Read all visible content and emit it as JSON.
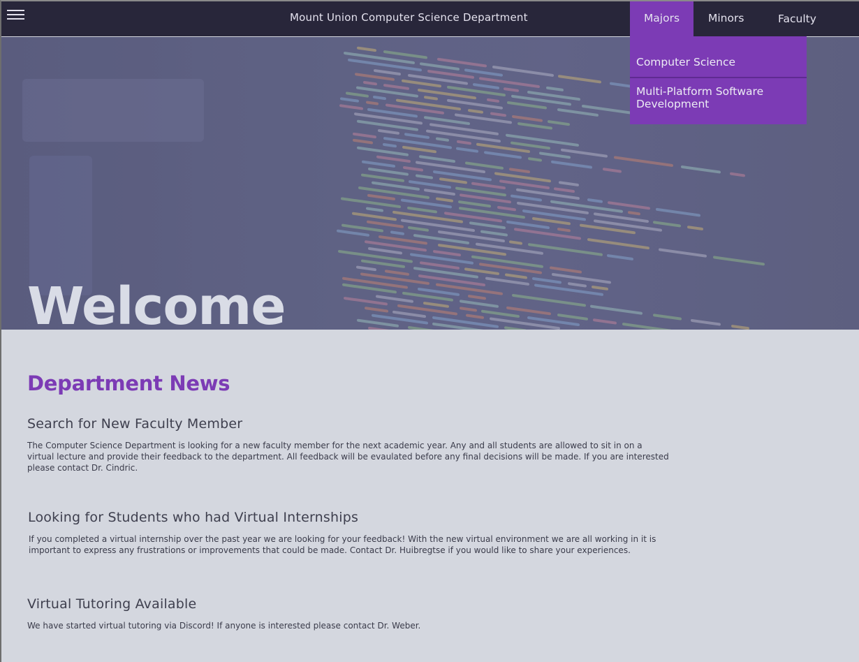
{
  "navbar": {
    "menu_icon": "hamburger-menu-icon",
    "title": "Mount Union Computer Science Department",
    "items": [
      {
        "label": "Majors"
      },
      {
        "label": "Minors"
      },
      {
        "label": "Faculty"
      }
    ]
  },
  "majors_dropdown": {
    "items": [
      {
        "label": "Computer Science"
      },
      {
        "label": "Multi-Platform Software Development"
      }
    ]
  },
  "hero": {
    "heading": "Welcome"
  },
  "news": {
    "heading": "Department News",
    "articles": [
      {
        "title": "Search for New Faculty Member",
        "body": "The Computer Science Department is looking for a new faculty member for the next academic year. Any and all students are allowed to sit in on a virtual lecture and provide their feedback to the department. All feedback will be evaulated before any final decisions will be made. If you are interested please contact Dr. Cindric."
      },
      {
        "title": "Looking for Students who had Virtual Internships",
        "body": "If you completed a virtual internship over the past year we are looking for your feedback! With the new virtual environment we are all working in it is important to express any frustrations or improvements that could be made. Contact Dr. Huibregtse if you would like to share your experiences."
      },
      {
        "title": "Virtual Tutoring Available",
        "body": "We have started virtual tutoring via Discord! If anyone is interested please contact Dr. Weber."
      }
    ]
  },
  "colors": {
    "navbar_bg": "#28263a",
    "accent_purple": "#7c3bb5",
    "page_bg": "#d4d7df"
  }
}
